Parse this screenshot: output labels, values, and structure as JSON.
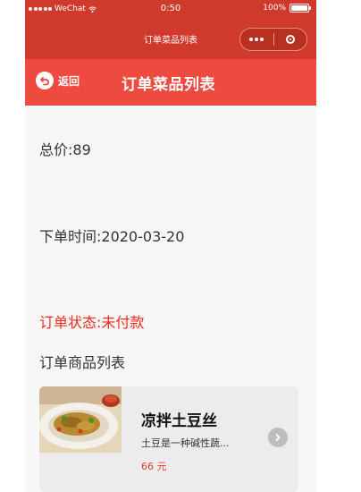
{
  "status_bar": {
    "carrier": "WeChat",
    "time": "0:50",
    "battery": "100%"
  },
  "mini_program_nav": {
    "title": "订单菜品列表"
  },
  "header": {
    "back_label": "返回",
    "title": "订单菜品列表"
  },
  "order": {
    "total": "总价:89",
    "order_time": "下单时间:2020-03-20",
    "status": "订单状态:未付款",
    "items_heading": "订单商品列表"
  },
  "items": [
    {
      "name": "凉拌土豆丝",
      "description": "土豆是一种碱性蔬...",
      "price": "66 元"
    }
  ],
  "colors": {
    "nav_red": "#cf3a2c",
    "header_red": "#ef4a3f",
    "status_red": "#f02b1a"
  },
  "icons": {
    "back": "back-arrow-icon",
    "more": "more-dots-icon",
    "close": "close-circle-icon",
    "item_arrow": "chevron-right-icon"
  }
}
